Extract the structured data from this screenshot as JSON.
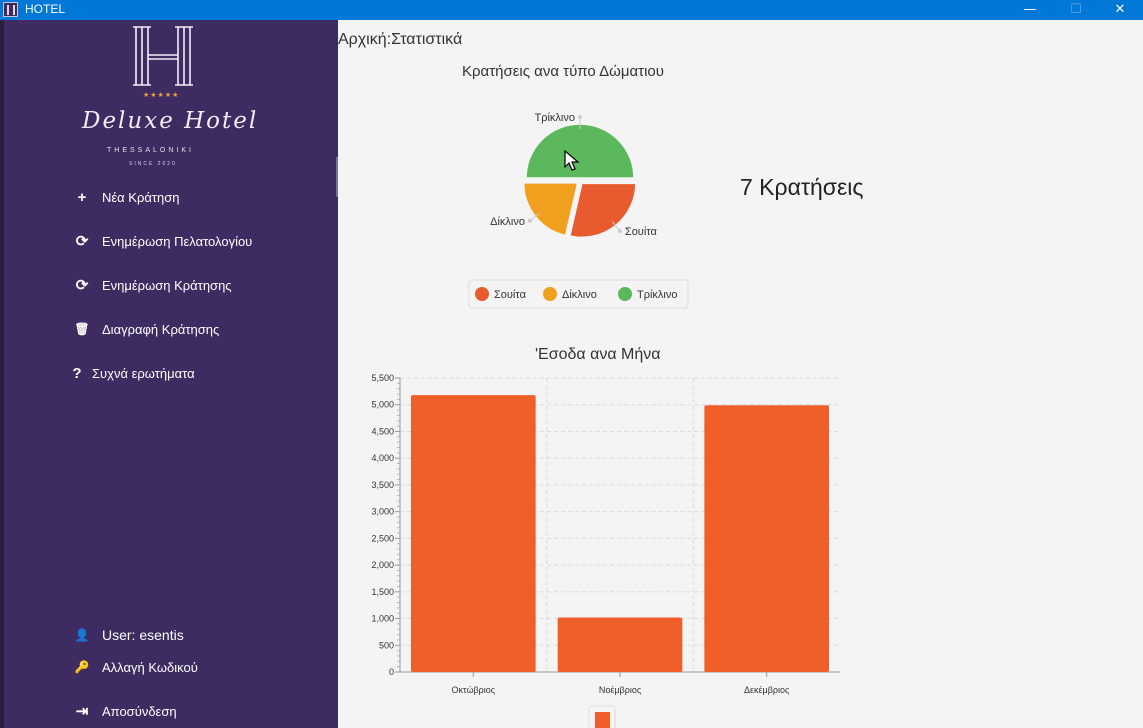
{
  "window": {
    "title": "HOTEL",
    "minimize": "—",
    "maximize": "☐",
    "close": "✕"
  },
  "sidebar": {
    "brand": {
      "name": "Deluxe Hotel",
      "city": "THESSALONIKI",
      "since": "SINCE 2020",
      "stars": "★★★★★"
    },
    "menu": [
      {
        "label": "Νέα Κράτηση",
        "icon": "plus-icon",
        "glyph": "+"
      },
      {
        "label": "Ενημέρωση Πελατολογίου",
        "icon": "refresh-icon",
        "glyph": "⟳"
      },
      {
        "label": "Ενημέρωση Κράτησης",
        "icon": "refresh-icon",
        "glyph": "⟳"
      },
      {
        "label": "Διαγραφή Κράτησης",
        "icon": "trash-icon",
        "glyph": "🗑"
      },
      {
        "label": "Συχνά ερωτήματα",
        "icon": "question-icon",
        "glyph": "?"
      }
    ],
    "footer": [
      {
        "label": "User: esentis",
        "icon": "user-icon",
        "glyph": "👤"
      },
      {
        "label": "Αλλαγή Κωδικού",
        "icon": "key-icon",
        "glyph": "🔑"
      },
      {
        "label": "Αποσύνδεση",
        "icon": "logout-icon",
        "glyph": "⇥"
      }
    ]
  },
  "content": {
    "breadcrumb": "Αρχική:Στατιστικά",
    "bookings_count": "7 Κρατήσεις"
  },
  "chart_data": [
    {
      "type": "pie",
      "title": "Κρατήσεις ανα τύπο Δώματιου",
      "categories": [
        "Σουίτα",
        "Δίκλινο",
        "Τρίκλινο"
      ],
      "values": [
        2,
        1.5,
        3.5
      ],
      "colors": [
        "#e85b2e",
        "#f0a01e",
        "#5cb85c"
      ],
      "legend": "bottom"
    },
    {
      "type": "bar",
      "title": "'Εσοδα ανα Μήνα",
      "categories": [
        "Οκτώβριος",
        "Νοέμβριος",
        "Δεκέμβριος"
      ],
      "values": [
        5180,
        1020,
        4990
      ],
      "ylim": [
        0,
        5500
      ],
      "yticks": [
        "0",
        "500",
        "1,000",
        "1,500",
        "2,000",
        "2,500",
        "3,000",
        "3,500",
        "4,000",
        "4,500",
        "5,000",
        "5,500"
      ],
      "color": "#f05f2a",
      "grid": true
    }
  ]
}
